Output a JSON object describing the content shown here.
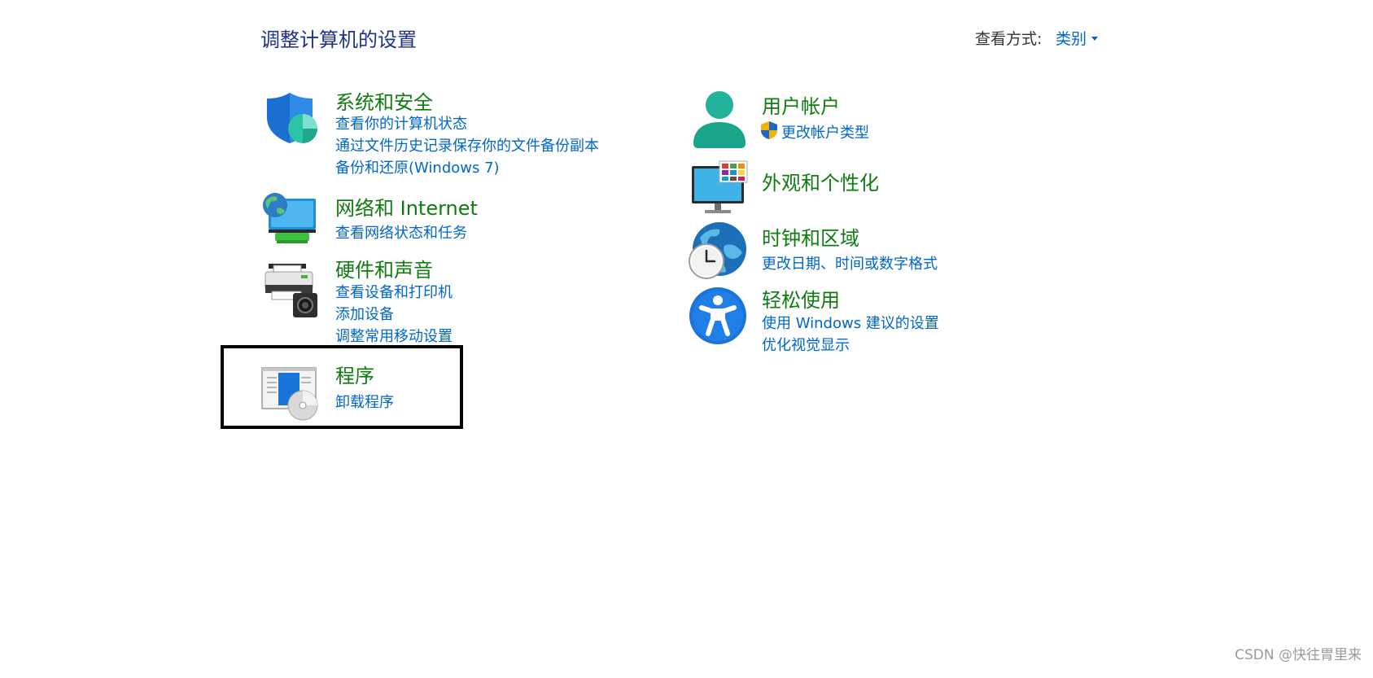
{
  "header": {
    "title": "调整计算机的设置",
    "view_by_label": "查看方式:",
    "view_by_value": "类别"
  },
  "categories": {
    "system_security": {
      "icon": "shield-icon",
      "title": "系统和安全",
      "links": [
        "查看你的计算机状态",
        "通过文件历史记录保存你的文件备份副本",
        "备份和还原(Windows 7)"
      ]
    },
    "network": {
      "icon": "network-globe-icon",
      "title": "网络和 Internet",
      "links": [
        "查看网络状态和任务"
      ]
    },
    "hardware": {
      "icon": "printer-icon",
      "title": "硬件和声音",
      "links": [
        "查看设备和打印机",
        "添加设备",
        "调整常用移动设置"
      ]
    },
    "programs": {
      "icon": "programs-disc-icon",
      "title": "程序",
      "links": [
        "卸载程序"
      ]
    },
    "user_accounts": {
      "icon": "user-icon",
      "title": "用户帐户",
      "links": [
        "更改帐户类型"
      ]
    },
    "appearance": {
      "icon": "monitor-color-icon",
      "title": "外观和个性化",
      "links": []
    },
    "clock_region": {
      "icon": "clock-globe-icon",
      "title": "时钟和区域",
      "links": [
        "更改日期、时间或数字格式"
      ]
    },
    "ease_of_access": {
      "icon": "accessibility-icon",
      "title": "轻松使用",
      "links": [
        "使用 Windows 建议的设置",
        "优化视觉显示"
      ]
    }
  },
  "watermark": "CSDN @快往胃里来",
  "colors": {
    "title_blue": "#1e3287",
    "category_green": "#107c10",
    "link_blue": "#0066cc",
    "highlight_border": "#000000"
  }
}
